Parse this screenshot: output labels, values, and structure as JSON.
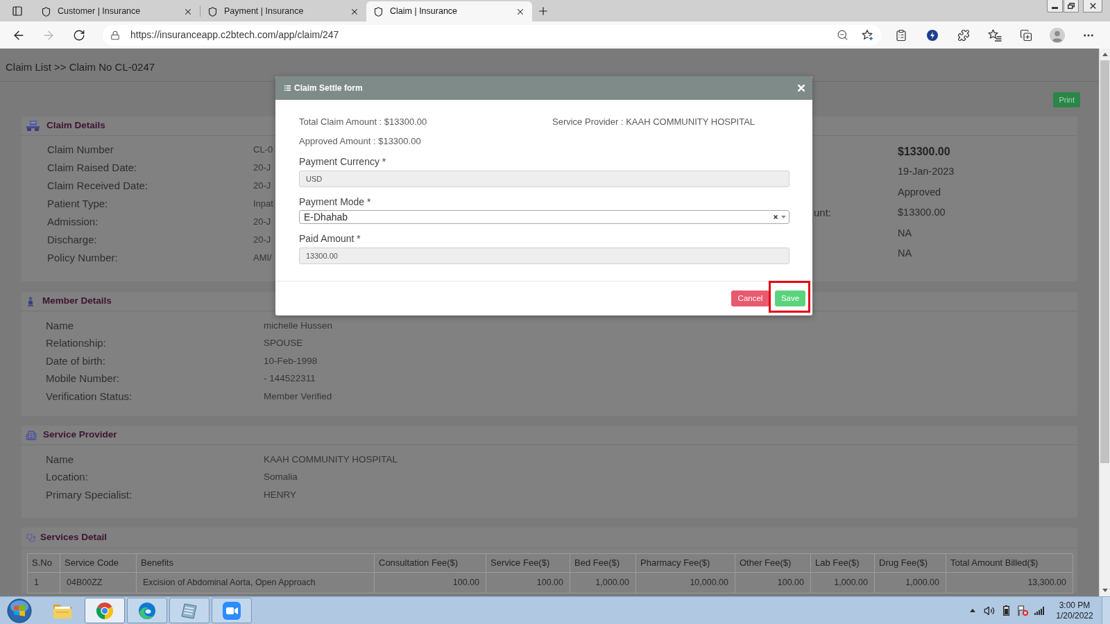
{
  "browser": {
    "tabs": [
      {
        "title": "Customer | Insurance",
        "selected": false
      },
      {
        "title": "Payment | Insurance",
        "selected": false
      },
      {
        "title": "Claim | Insurance",
        "selected": true
      }
    ],
    "url": "https://insuranceapp.c2btech.com/app/claim/247"
  },
  "page": {
    "breadcrumb": "Claim List >> Claim No CL-0247",
    "print_button": "Print",
    "claim_details": {
      "title": "Claim Details",
      "rows": [
        {
          "label": "Claim Number",
          "value": "CL-0"
        },
        {
          "label": "Claim Raised Date:",
          "value": "20-J"
        },
        {
          "label": "Claim Received Date:",
          "value": "20-J"
        },
        {
          "label": "Patient Type:",
          "value": "Inpat"
        },
        {
          "label": "Admission:",
          "value": "20-J"
        },
        {
          "label": "Discharge:",
          "value": "20-J"
        },
        {
          "label": "Policy Number:",
          "value": "AMI/"
        }
      ],
      "right_rows": [
        {
          "value": "$13300.00",
          "emphasized": true
        },
        {
          "value": "19-Jan-2023",
          "emphasized": false
        },
        {
          "value": "Approved",
          "emphasized": false
        },
        {
          "label": "unt:",
          "value": "$13300.00",
          "emphasized": false
        },
        {
          "value": "NA",
          "emphasized": false
        },
        {
          "value": "NA",
          "emphasized": false
        }
      ]
    },
    "member_details": {
      "title": "Member Details",
      "rows": [
        {
          "label": "Name",
          "value": "michelle Hussen"
        },
        {
          "label": "Relationship:",
          "value": "SPOUSE"
        },
        {
          "label": "Date of birth:",
          "value": "10-Feb-1998"
        },
        {
          "label": "Mobile Number:",
          "value": "- 144522311"
        },
        {
          "label": "Verification Status:",
          "value": "Member Verified"
        }
      ]
    },
    "service_provider": {
      "title": "Service Provider",
      "rows": [
        {
          "label": "Name",
          "value": "KAAH COMMUNITY HOSPITAL"
        },
        {
          "label": "Location:",
          "value": "Somalia"
        },
        {
          "label": "Primary Specialist:",
          "value": "HENRY"
        }
      ]
    },
    "services_detail": {
      "title": "Services Detail",
      "table": {
        "columns": [
          "S.No",
          "Service Code",
          "Benefits",
          "Consultation Fee($)",
          "Service Fee($)",
          "Bed Fee($)",
          "Pharmacy Fee($)",
          "Other Fee($)",
          "Lab Fee($)",
          "Drug Fee($)",
          "Total Amount Billed($)"
        ],
        "rows": [
          [
            "1",
            "04B00ZZ",
            "Excision of Abdominal Aorta, Open Approach",
            "100.00",
            "100.00",
            "1,000.00",
            "10,000.00",
            "100.00",
            "1,000.00",
            "1,000.00",
            "13,300.00"
          ]
        ]
      }
    }
  },
  "modal": {
    "title": "Claim Settle form",
    "total_claim": "Total Claim Amount : $13300.00",
    "service_provider": "Service Provider : KAAH COMMUNITY HOSPITAL",
    "approved": "Approved Amount : $13300.00",
    "fields": [
      {
        "kind": "readonly",
        "label": "Payment Currency *",
        "value": "USD"
      },
      {
        "kind": "select",
        "label": "Payment Mode *",
        "value": "E-Dhahab"
      },
      {
        "kind": "readonly",
        "label": "Paid Amount *",
        "value": "13300.00"
      }
    ],
    "buttons": [
      {
        "kind": "cancel",
        "label": "Cancel",
        "highlighted": false
      },
      {
        "kind": "save",
        "label": "Save",
        "highlighted": true
      }
    ]
  },
  "taskbar": {
    "apps": [
      {
        "running": false,
        "selected": false
      },
      {
        "running": true,
        "selected": true
      },
      {
        "running": true,
        "selected": false
      },
      {
        "running": true,
        "selected": false
      },
      {
        "running": true,
        "selected": false
      }
    ],
    "time": "3:00 PM",
    "date": "1/20/2022"
  }
}
